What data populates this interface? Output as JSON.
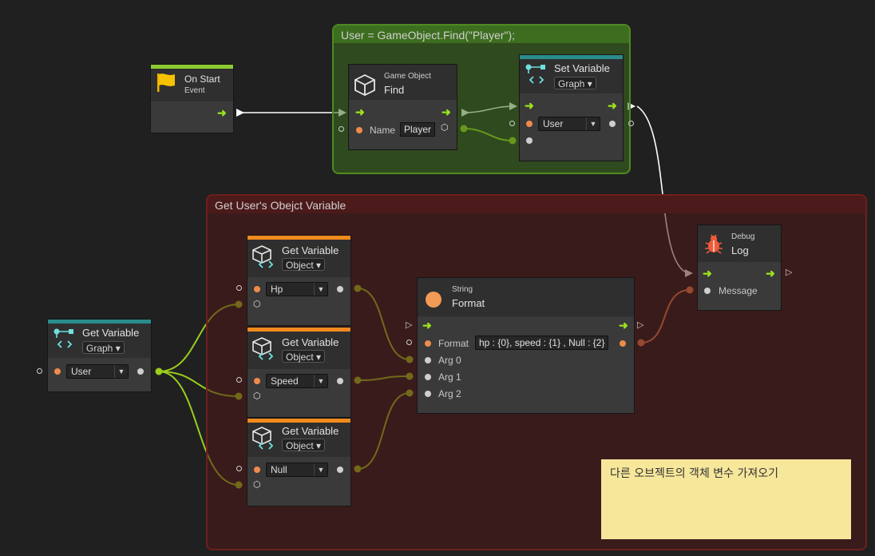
{
  "groups": {
    "find_player": {
      "title": "User = GameObject.Find(\"Player\");"
    },
    "get_user_variable": {
      "title": "Get User's Obejct Variable"
    }
  },
  "nodes": {
    "on_start": {
      "title": "On Start",
      "subtitle": "Event"
    },
    "find": {
      "category": "Game Object",
      "title": "Find",
      "name_label": "Name",
      "name_value": "Player"
    },
    "set_variable": {
      "title": "Set Variable",
      "kind": "Graph",
      "variable": "User"
    },
    "debug_log": {
      "category": "Debug",
      "title": "Log",
      "message_label": "Message"
    },
    "get_user": {
      "title": "Get Variable",
      "kind": "Graph",
      "variable": "User"
    },
    "get_hp": {
      "title": "Get Variable",
      "kind": "Object",
      "variable": "Hp"
    },
    "get_speed": {
      "title": "Get Variable",
      "kind": "Object",
      "variable": "Speed"
    },
    "get_null": {
      "title": "Get Variable",
      "kind": "Object",
      "variable": "Null"
    },
    "string_format": {
      "category": "String",
      "title": "Format",
      "format_label": "Format",
      "format_value": "hp : {0}, speed : {1} , Null : {2}",
      "arg0": "Arg 0",
      "arg1": "Arg 1",
      "arg2": "Arg 2"
    }
  },
  "sticky_note": {
    "text": "다른 오브젝트의 객체 변수 가져오기"
  },
  "colors": {
    "background": "#202020",
    "event_bar": "#8ccc32",
    "graph_var_bar": "#2a8c8c",
    "object_var_bar": "#f08a1e",
    "group_green": "#335d1b",
    "group_red": "#4a1a1a",
    "flow_arrow": "#9be21f",
    "data_wire": "#9acd1e",
    "string_wire": "#e8864a",
    "control_wire": "#ffffff",
    "sticky": "#f7e79b"
  },
  "icons": {
    "on_start": "flag-icon",
    "find": "cube-icon",
    "set_variable": "variable-graph-icon",
    "debug_log": "bug-icon",
    "string_format": "string-circle-icon",
    "get_object_variable": "variable-cube-icon"
  }
}
